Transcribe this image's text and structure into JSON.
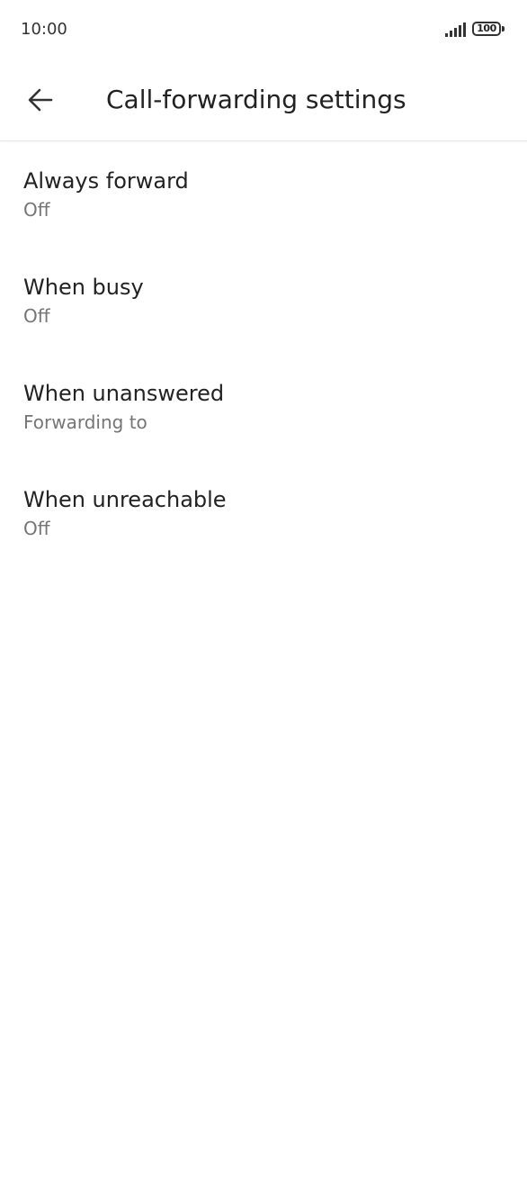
{
  "status_bar": {
    "time": "10:00",
    "battery_level": "100"
  },
  "header": {
    "back_icon": "arrow-left-icon",
    "title": "Call-forwarding settings"
  },
  "settings": {
    "items": [
      {
        "title": "Always forward",
        "summary": "Off"
      },
      {
        "title": "When busy",
        "summary": "Off"
      },
      {
        "title": "When unanswered",
        "summary": "Forwarding to"
      },
      {
        "title": "When unreachable",
        "summary": "Off"
      }
    ]
  },
  "colors": {
    "primary_text": "#222222",
    "secondary_text": "#757575",
    "background": "#ffffff",
    "divider": "#e6e6e6"
  }
}
